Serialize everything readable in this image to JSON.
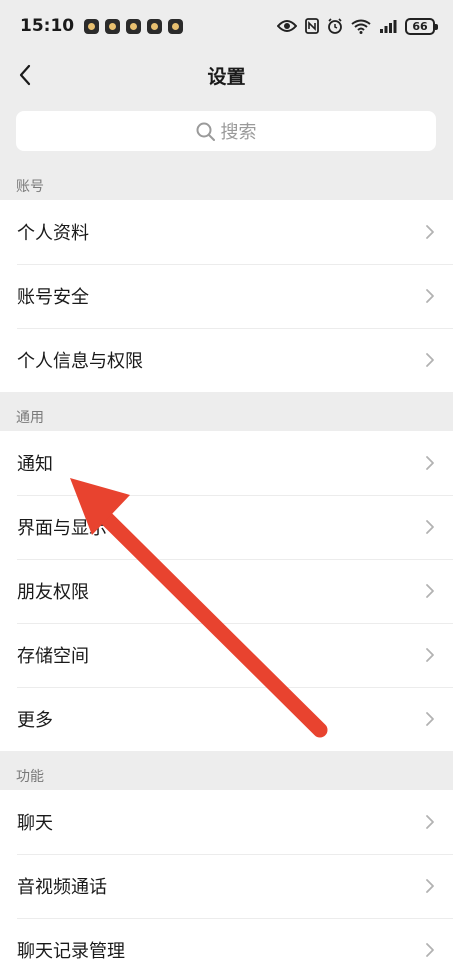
{
  "status_bar": {
    "time": "15:10",
    "battery": "66"
  },
  "nav": {
    "title": "设置"
  },
  "search": {
    "placeholder": "搜索"
  },
  "sections": [
    {
      "title": "账号",
      "items": [
        "个人资料",
        "账号安全",
        "个人信息与权限"
      ]
    },
    {
      "title": "通用",
      "items": [
        "通知",
        "界面与显示",
        "朋友权限",
        "存储空间",
        "更多"
      ]
    },
    {
      "title": "功能",
      "items": [
        "聊天",
        "音视频通话",
        "聊天记录管理"
      ]
    }
  ],
  "colors": {
    "background": "#ededed",
    "card": "#ffffff",
    "annotation_arrow": "#e8432f"
  }
}
